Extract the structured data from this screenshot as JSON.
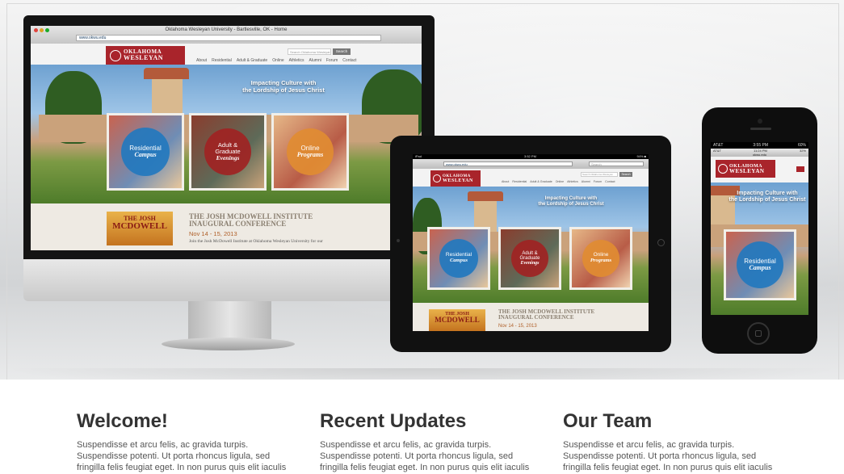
{
  "site": {
    "window_title": "Oklahoma Wesleyan University - Bartlesville, OK - Home",
    "url": "www.okwu.edu",
    "logo_line1": "OKLAHOMA",
    "logo_line2": "WESLEYAN",
    "logo_line3": "UNIVERSITY",
    "search_placeholder": "Search Oklahoma Wesleyan",
    "search_button": "Search",
    "nav": [
      "About",
      "Residential",
      "Adult & Graduate",
      "Online",
      "Athletics",
      "Alumni",
      "Forum",
      "Contact"
    ],
    "tagline_line1": "Impacting Culture with",
    "tagline_line2": "the Lordship of Jesus Christ",
    "cards": [
      {
        "line1": "Residential",
        "line2": "Campus",
        "color": "#2378be"
      },
      {
        "line1": "Adult &",
        "line1b": "Graduate",
        "line2": "Evenings",
        "color": "#a02323"
      },
      {
        "line1": "Online",
        "line2": "Programs",
        "color": "#e18c32"
      }
    ],
    "promo": {
      "thumb_line1": "THE JOSH",
      "thumb_line2": "MCDOWELL",
      "title_line1": "THE JOSH MCDOWELL INSTITUTE",
      "title_line2": "INAUGURAL CONFERENCE",
      "date": "Nov 14 - 15, 2013",
      "desc": "Join the Josh McDowell Institute at Oklahoma Wesleyan University for our"
    }
  },
  "devices": {
    "ipad_status_left": "iPad",
    "ipad_status_time": "3:52 PM",
    "ipad_status_right": "94% ■",
    "ipad_search": "Search",
    "iphone_carrier": "AT&T",
    "iphone_time": "3:55 PM",
    "iphone_battery": "60%",
    "iphone_inner_carrier": "AT&T",
    "iphone_inner_time": "11:24 PM",
    "iphone_inner_battery": "32%",
    "iphone_url": "okwu.edu"
  },
  "columns": [
    {
      "title": "Welcome!",
      "text": "Suspendisse et arcu felis, ac gravida turpis. Suspendisse potenti. Ut porta rhoncus ligula, sed fringilla felis feugiat eget. In non purus quis elit iaculis"
    },
    {
      "title": "Recent Updates",
      "text": "Suspendisse et arcu felis, ac gravida turpis. Suspendisse potenti. Ut porta rhoncus ligula, sed fringilla felis feugiat eget. In non purus quis elit iaculis"
    },
    {
      "title": "Our Team",
      "text": "Suspendisse et arcu felis, ac gravida turpis. Suspendisse potenti. Ut porta rhoncus ligula, sed fringilla felis feugiat eget. In non purus quis elit iaculis"
    }
  ]
}
